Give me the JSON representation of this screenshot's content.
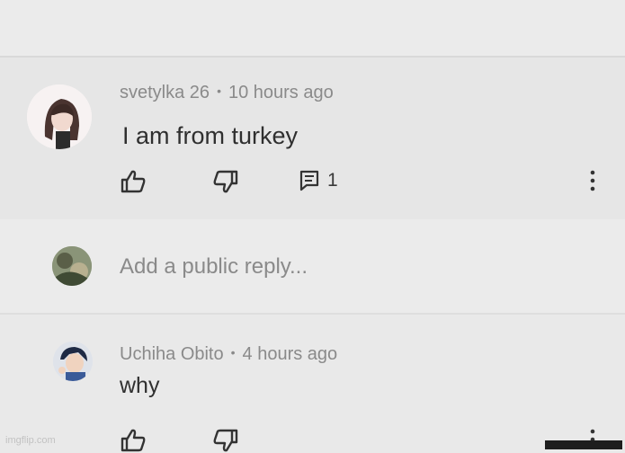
{
  "comment": {
    "author": "svetylka 26",
    "separator": "•",
    "time": "10 hours ago",
    "text": "I am from turkey",
    "reply_count": "1"
  },
  "reply_box": {
    "placeholder": "Add a public reply..."
  },
  "reply": {
    "author": "Uchiha Obito",
    "separator": "•",
    "time": "4 hours ago",
    "text": "why"
  },
  "watermark": "imgflip.com",
  "icons": {
    "like": "thumb-up-icon",
    "dislike": "thumb-down-icon",
    "reply": "comment-icon",
    "menu": "more-vertical-icon"
  }
}
